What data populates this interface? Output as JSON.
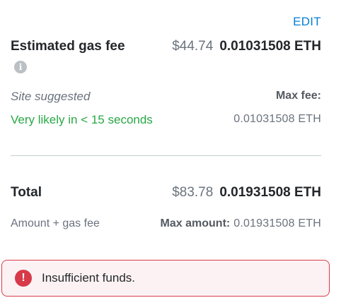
{
  "edit_label": "EDIT",
  "gas": {
    "title": "Estimated gas fee",
    "fiat": "$44.74",
    "eth": "0.01031508 ETH",
    "info_icon": "info-icon"
  },
  "suggestion": {
    "site_suggested": "Site suggested",
    "likely": "Very likely in < 15 seconds",
    "max_fee_label": "Max fee:",
    "max_fee_value": "0.01031508 ETH"
  },
  "total": {
    "title": "Total",
    "fiat": "$83.78",
    "eth": "0.01931508 ETH",
    "subtitle": "Amount + gas fee",
    "max_amount_label": "Max amount:",
    "max_amount_value": "0.01931508 ETH"
  },
  "alert": {
    "icon": "exclamation-icon",
    "message": "Insufficient funds."
  },
  "colors": {
    "link": "#037dd6",
    "success": "#28a745",
    "error": "#d73a49",
    "error_bg": "#fcf2f3"
  }
}
